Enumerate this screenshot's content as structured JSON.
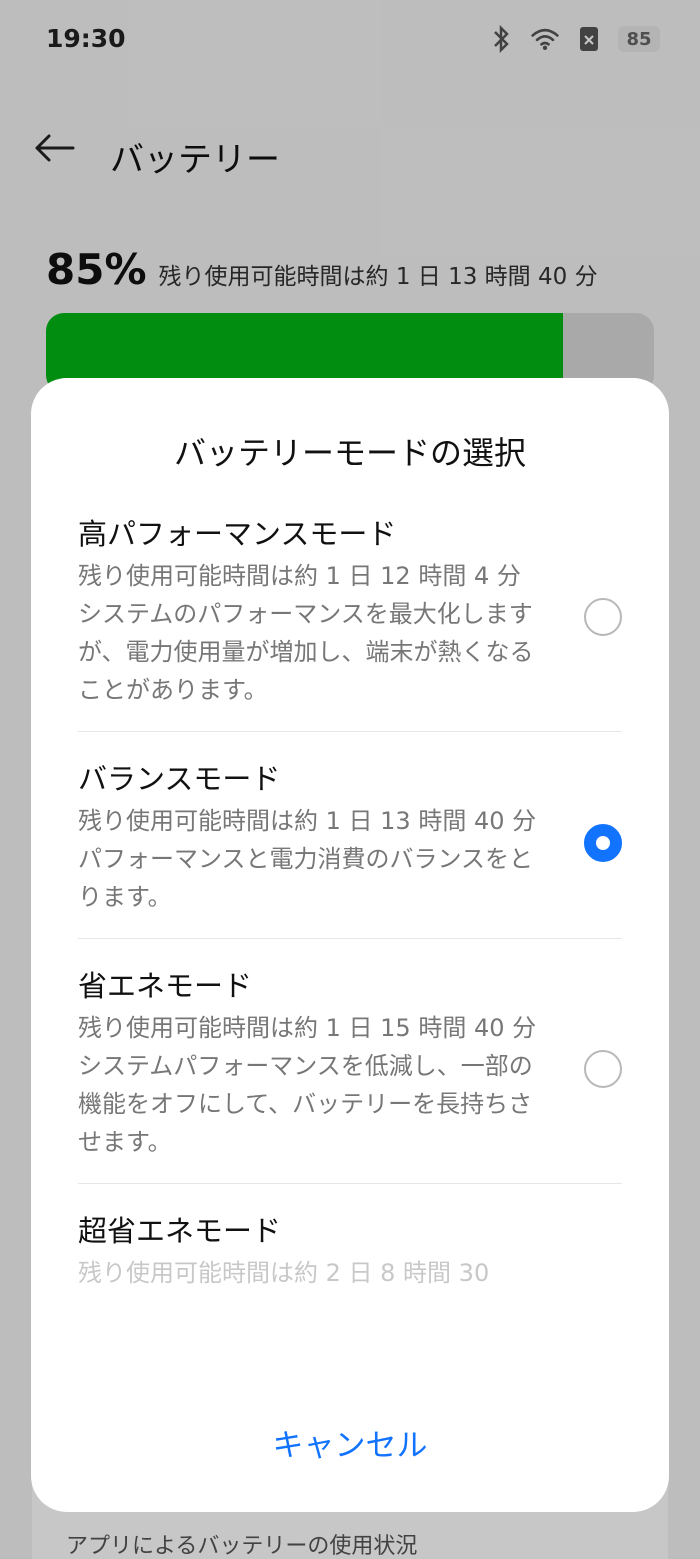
{
  "status_bar": {
    "time": "19:30",
    "battery_level": "85"
  },
  "header": {
    "title": "バッテリー"
  },
  "summary": {
    "percent": "85%",
    "remaining": "残り使用可能時間は約 1 日 13 時間 40 分",
    "battery_fill_fraction": 0.85
  },
  "usage": {
    "label": "アプリによるバッテリーの使用状況"
  },
  "dialog": {
    "title": "バッテリーモードの選択",
    "cancel_label": "キャンセル",
    "modes": [
      {
        "name": "高パフォーマンスモード",
        "remaining": "残り使用可能時間は約 1 日 12 時間 4 分",
        "description": "システムのパフォーマンスを最大化しますが、電力使用量が増加し、端末が熱くなることがあります。",
        "selected": false
      },
      {
        "name": "バランスモード",
        "remaining": "残り使用可能時間は約 1 日 13 時間 40 分",
        "description": "パフォーマンスと電力消費のバランスをとります。",
        "selected": true
      },
      {
        "name": "省エネモード",
        "remaining": "残り使用可能時間は約 1 日 15 時間 40 分",
        "description": "システムパフォーマンスを低減し、一部の機能をオフにして、バッテリーを長持ちさせます。",
        "selected": false
      },
      {
        "name": "超省エネモード",
        "remaining": "残り使用可能時間は約 2 日 8 時間 30",
        "description": "",
        "selected": false
      }
    ]
  },
  "colors": {
    "accent": "#1273ff",
    "battery_green": "#00b515"
  }
}
